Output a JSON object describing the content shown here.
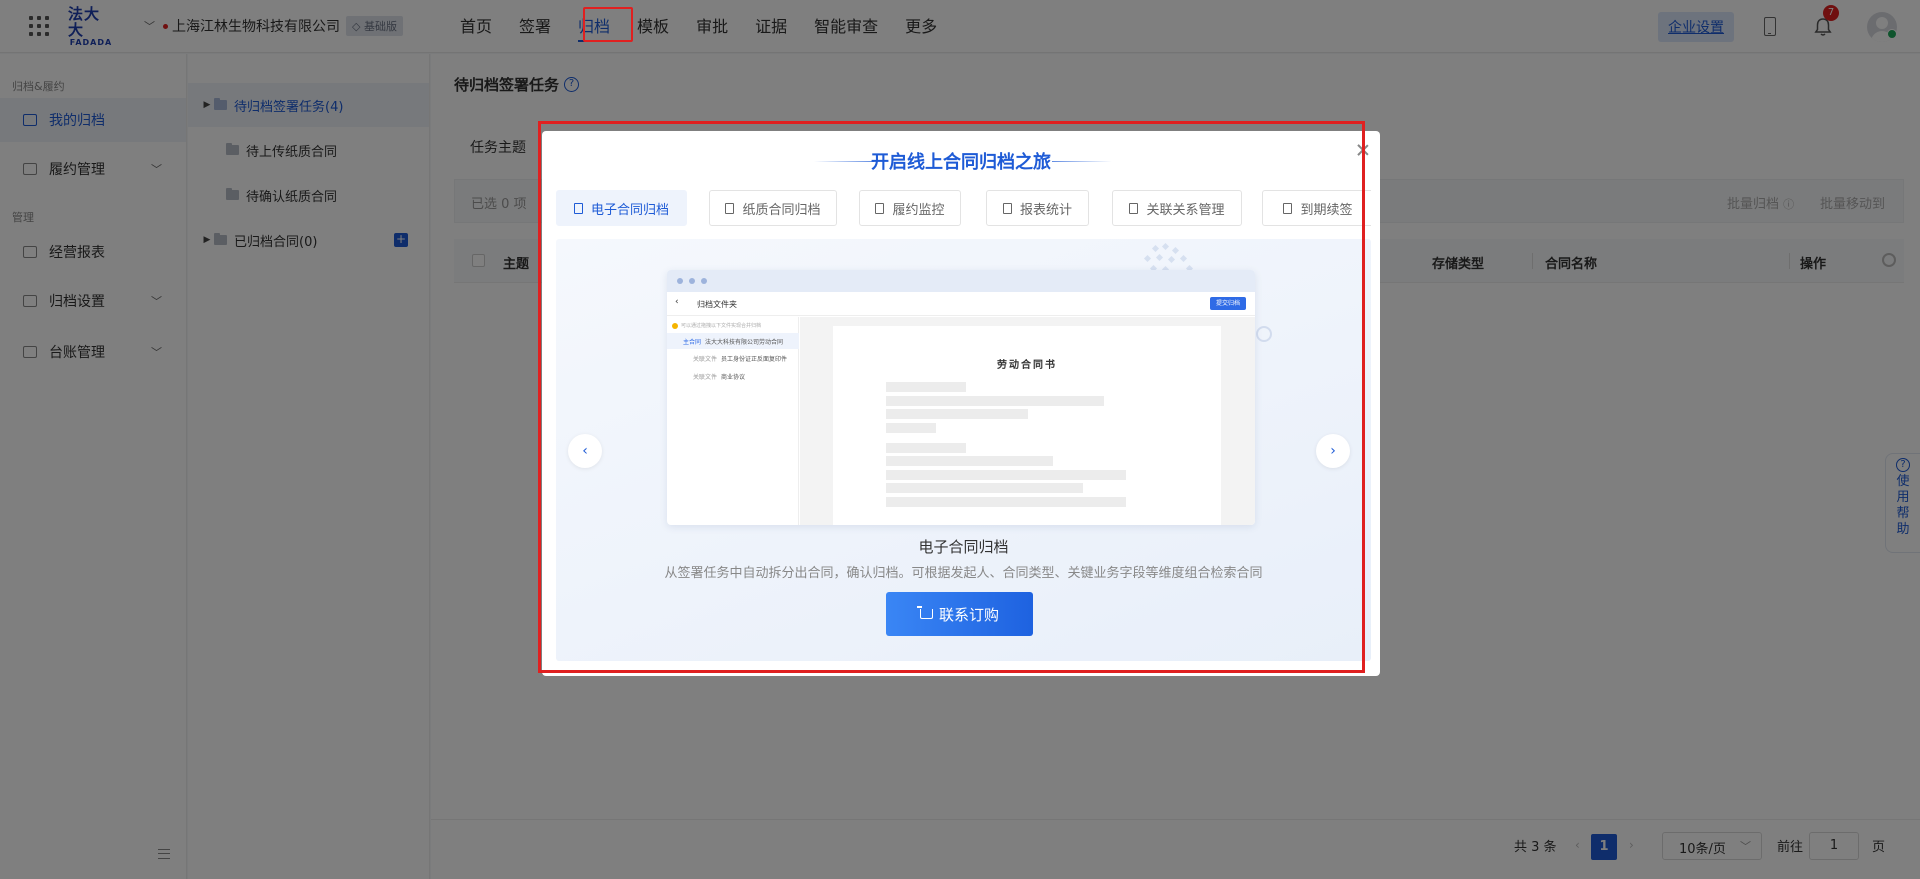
{
  "header": {
    "logo_cn": "法大大",
    "logo_en": "FADADA",
    "company": "上海江林生物科技有限公司",
    "edition_badge": "基础版",
    "nav": [
      "首页",
      "签署",
      "归档",
      "模板",
      "审批",
      "证据",
      "智能审查",
      "更多"
    ],
    "active_nav": "归档",
    "enterprise_settings": "企业设置",
    "notification_count": "7"
  },
  "sidebar": {
    "group1": "归档&履约",
    "my_archive": "我的归档",
    "performance": "履约管理",
    "group2": "管理",
    "reports": "经营报表",
    "archive_settings": "归档设置",
    "ledger": "台账管理"
  },
  "tree": {
    "items": [
      "待归档签署任务(4)",
      "待上传纸质合同",
      "待确认纸质合同",
      "已归档合同(0)"
    ],
    "add_label": "+"
  },
  "main": {
    "title": "待归档签署任务",
    "help": "?",
    "filter_label": "任务主题",
    "selected_count": "已选 0 项",
    "batch_archive": "批量归档",
    "batch_move": "批量移动到",
    "columns": {
      "subject": "主题",
      "storage_type": "存储类型",
      "contract_name": "合同名称",
      "actions": "操作"
    }
  },
  "pagination": {
    "total": "共 3 条",
    "current_page": "1",
    "page_size": "10条/页",
    "goto_label": "前往",
    "goto_value": "1",
    "page_unit": "页"
  },
  "help_tab": {
    "q": "?",
    "chars": [
      "使",
      "用",
      "帮",
      "助"
    ]
  },
  "modal": {
    "title": "开启线上合同归档之旅",
    "tabs": [
      "电子合同归档",
      "纸质合同归档",
      "履约监控",
      "报表统计",
      "关联关系管理",
      "到期续签"
    ],
    "active_tab": "电子合同归档",
    "preview": {
      "header_title": "归档文件夹",
      "header_button": "提交归档",
      "tip": "可以通过拖拽以下文件实现合并归档",
      "rows": [
        {
          "tag": "主合同",
          "text": "法大大科技有限公司劳动合同"
        },
        {
          "tag": "关联文件",
          "text": "员工身份证正反面复印件"
        },
        {
          "tag": "关联文件",
          "text": "商业协议"
        }
      ],
      "doc_title": "劳动合同书"
    },
    "feature_title": "电子合同归档",
    "feature_desc": "从签署任务中自动拆分出合同，确认归档。可根据发起人、合同类型、关键业务字段等维度组合检索合同",
    "cta_label": "联系订购"
  }
}
